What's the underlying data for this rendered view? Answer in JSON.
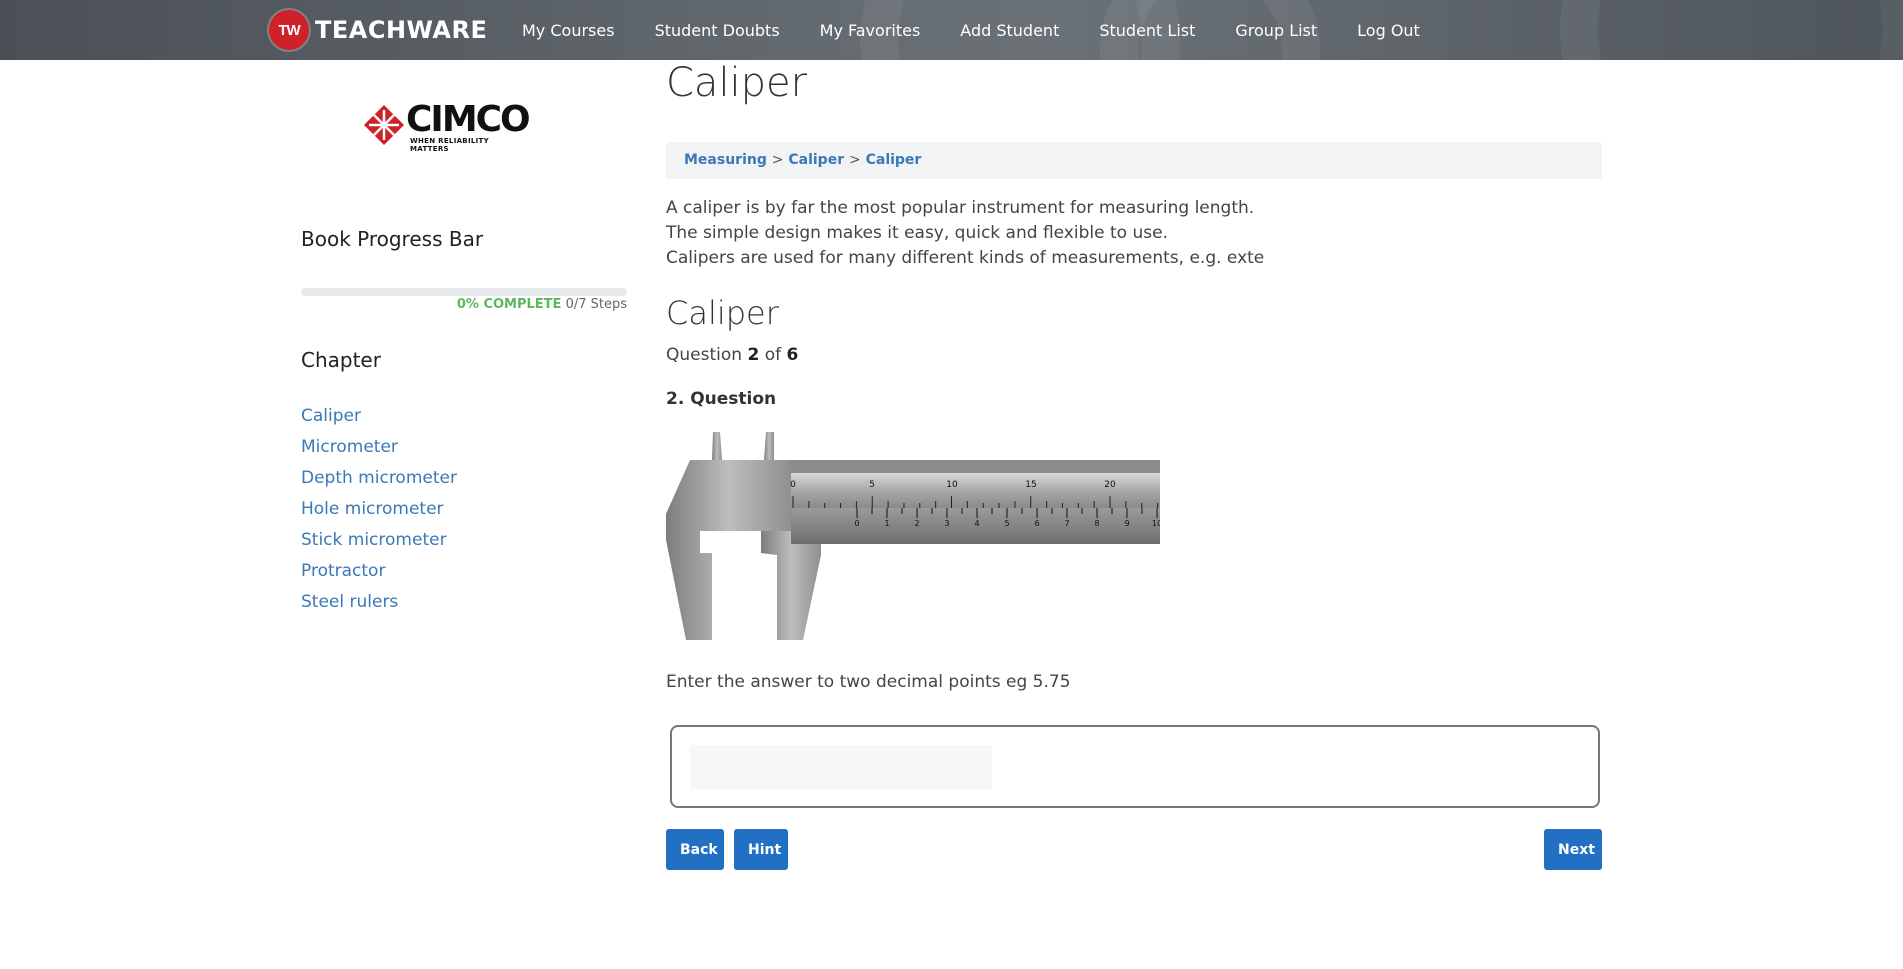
{
  "brand": {
    "badge": "TW",
    "name": "TEACHWARE"
  },
  "nav": {
    "items": [
      "My Courses",
      "Student Doubts",
      "My Favorites",
      "Add Student",
      "Student List",
      "Group List",
      "Log Out"
    ]
  },
  "sidebar": {
    "logo": {
      "name": "CIMCO",
      "tagline": "WHEN RELIABILITY MATTERS",
      "color": "#d0202a"
    },
    "progress_title": "Book Progress Bar",
    "progress": {
      "value": 0,
      "percent_label": "0% COMPLETE",
      "steps_label": "0/7 Steps"
    },
    "chapter_title": "Chapter",
    "chapters": [
      "Caliper",
      "Micrometer",
      "Depth micrometer",
      "Hole micrometer",
      "Stick micrometer",
      "Protractor",
      "Steel rulers"
    ]
  },
  "main": {
    "title": "Caliper",
    "breadcrumb": [
      {
        "label": "Measuring"
      },
      {
        "separator": ">"
      },
      {
        "label": "Caliper"
      },
      {
        "separator": ">"
      },
      {
        "label": "Caliper"
      }
    ],
    "description": [
      "A caliper is by far the most popular instrument for measuring length.",
      "The simple design makes it easy, quick and flexible to use.",
      "Calipers are used for many different kinds of measurements, e.g. exte"
    ],
    "quiz_title": "Caliper",
    "question_counter": {
      "prefix": "Question",
      "current": "2",
      "middle": "of",
      "total": "6"
    },
    "question_heading": "2. Question",
    "caliper_scale": {
      "main_labels": [
        "0",
        "5",
        "10",
        "15",
        "20"
      ],
      "vernier_labels": [
        "0",
        "1",
        "2",
        "3",
        "4",
        "5",
        "6",
        "7",
        "8",
        "9",
        "10"
      ]
    },
    "instruction": "Enter the answer to two decimal points eg 5.75",
    "answer": {
      "value": "",
      "placeholder": ""
    },
    "buttons": {
      "back": "Back",
      "hint": "Hint",
      "next": "Next"
    },
    "accent_color": "#2270c3"
  }
}
